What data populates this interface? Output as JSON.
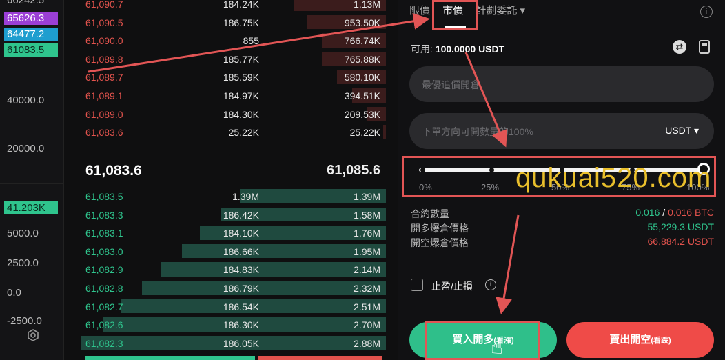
{
  "axis": {
    "top_cut": "66242.5",
    "tags": [
      {
        "label": "65626.3",
        "color": "#9b3fd6"
      },
      {
        "label": "64477.2",
        "color": "#1e9ecf"
      },
      {
        "label": "61083.5",
        "color": "#2fc48d"
      }
    ],
    "ticks": [
      "40000.0",
      "20000.0",
      "5000.0",
      "2500.0",
      "0.0",
      "-2500.0"
    ],
    "volume_tag": "41.203K"
  },
  "orderbook": {
    "asks": [
      {
        "price": "61,090.7",
        "qty": "184.24K",
        "total": "1.13M",
        "depth": 0.3
      },
      {
        "price": "61,090.5",
        "qty": "186.75K",
        "total": "953.50K",
        "depth": 0.26
      },
      {
        "price": "61,090.0",
        "qty": "855",
        "total": "766.74K",
        "depth": 0.21
      },
      {
        "price": "61,089.8",
        "qty": "185.77K",
        "total": "765.88K",
        "depth": 0.21
      },
      {
        "price": "61,089.7",
        "qty": "185.59K",
        "total": "580.10K",
        "depth": 0.16
      },
      {
        "price": "61,089.1",
        "qty": "184.97K",
        "total": "394.51K",
        "depth": 0.11
      },
      {
        "price": "61,089.0",
        "qty": "184.30K",
        "total": "209.53K",
        "depth": 0.06
      },
      {
        "price": "61,083.6",
        "qty": "25.22K",
        "total": "25.22K",
        "depth": 0.01
      }
    ],
    "last_price": "61,083.6",
    "mark_price": "61,085.6",
    "bids": [
      {
        "price": "61,083.5",
        "qty": "1.39M",
        "total": "1.39M",
        "depth": 0.48
      },
      {
        "price": "61,083.3",
        "qty": "186.42K",
        "total": "1.58M",
        "depth": 0.54
      },
      {
        "price": "61,083.1",
        "qty": "184.10K",
        "total": "1.76M",
        "depth": 0.61
      },
      {
        "price": "61,083.0",
        "qty": "186.66K",
        "total": "1.95M",
        "depth": 0.67
      },
      {
        "price": "61,082.9",
        "qty": "184.83K",
        "total": "2.14M",
        "depth": 0.74
      },
      {
        "price": "61,082.8",
        "qty": "186.79K",
        "total": "2.32M",
        "depth": 0.8
      },
      {
        "price": "61,082.7",
        "qty": "186.54K",
        "total": "2.51M",
        "depth": 0.87
      },
      {
        "price": "61,082.6",
        "qty": "186.30K",
        "total": "2.70M",
        "depth": 0.93
      },
      {
        "price": "61,082.3",
        "qty": "186.05K",
        "total": "2.88M",
        "depth": 1.0
      }
    ]
  },
  "panel": {
    "tabs": [
      "限價",
      "市價",
      "計劃委託 ▾"
    ],
    "active_tab": 1,
    "available": {
      "label": "可用:",
      "value": "100.0000 USDT"
    },
    "price_placeholder": "最優追價開倉",
    "amount_placeholder": "下單方向可開數量的100%",
    "amount_unit": "USDT ▾",
    "slider": {
      "value_percent": 100,
      "labels": [
        "0%",
        "25%",
        "50%",
        "75%",
        "100%"
      ]
    },
    "details": [
      {
        "label": "合約數量",
        "value_a": "0.016",
        "sep": " / ",
        "value_b": "0.016 BTC"
      },
      {
        "label": "開多爆倉價格",
        "value": "55,229.3 USDT",
        "color": "#2fc48d"
      },
      {
        "label": "開空爆倉價格",
        "value": "66,884.2 USDT",
        "color": "#e2534d"
      }
    ],
    "tpsl_label": "止盈/止損",
    "buy": {
      "label": "買入開多",
      "sub": "(看漲)"
    },
    "sell": {
      "label": "賣出開空",
      "sub": "(看跌)"
    }
  },
  "watermark": "qukuai520.com"
}
